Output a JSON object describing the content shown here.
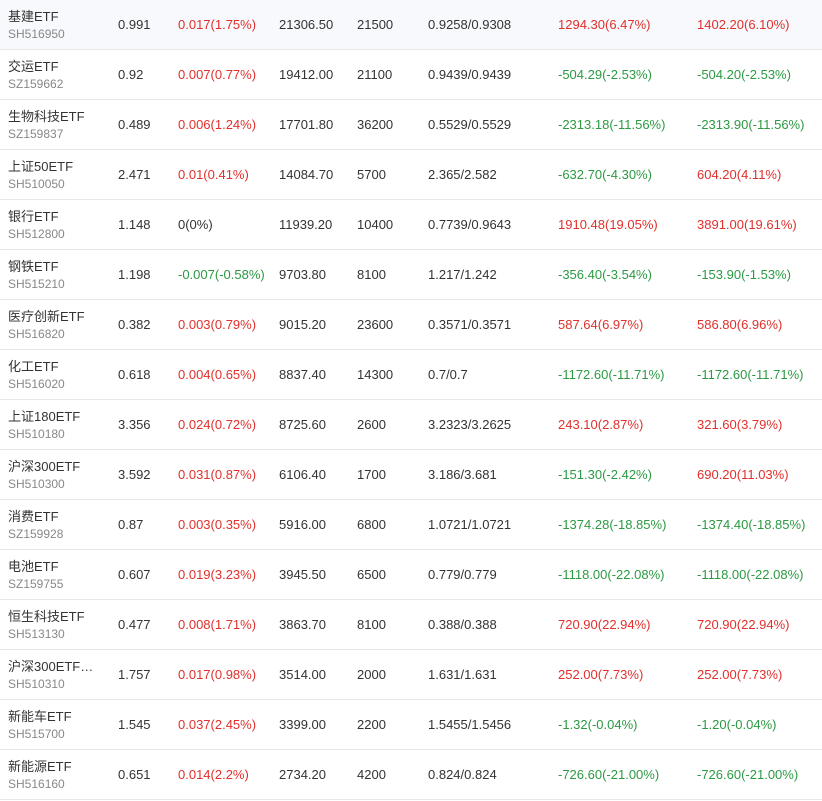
{
  "colors": {
    "up": "#e0302c",
    "down": "#2b9a43",
    "flat": "#333333",
    "text": "#333333",
    "subtext": "#888888",
    "divider": "#e8e8e8"
  },
  "rows": [
    {
      "name": "基建ETF",
      "code": "SH516950",
      "price": "0.991",
      "change": "0.017(1.75%)",
      "change_dir": "up",
      "market_value": "21306.50",
      "quantity": "21500",
      "cost": "0.9258/0.9308",
      "float_pl": "1294.30(6.47%)",
      "float_pl_dir": "up",
      "total_pl": "1402.20(6.10%)",
      "total_pl_dir": "up"
    },
    {
      "name": "交运ETF",
      "code": "SZ159662",
      "price": "0.92",
      "change": "0.007(0.77%)",
      "change_dir": "up",
      "market_value": "19412.00",
      "quantity": "21100",
      "cost": "0.9439/0.9439",
      "float_pl": "-504.29(-2.53%)",
      "float_pl_dir": "down",
      "total_pl": "-504.20(-2.53%)",
      "total_pl_dir": "down"
    },
    {
      "name": "生物科技ETF",
      "code": "SZ159837",
      "price": "0.489",
      "change": "0.006(1.24%)",
      "change_dir": "up",
      "market_value": "17701.80",
      "quantity": "36200",
      "cost": "0.5529/0.5529",
      "float_pl": "-2313.18(-11.56%)",
      "float_pl_dir": "down",
      "total_pl": "-2313.90(-11.56%)",
      "total_pl_dir": "down"
    },
    {
      "name": "上证50ETF",
      "code": "SH510050",
      "price": "2.471",
      "change": "0.01(0.41%)",
      "change_dir": "up",
      "market_value": "14084.70",
      "quantity": "5700",
      "cost": "2.365/2.582",
      "float_pl": "-632.70(-4.30%)",
      "float_pl_dir": "down",
      "total_pl": "604.20(4.11%)",
      "total_pl_dir": "up"
    },
    {
      "name": "银行ETF",
      "code": "SH512800",
      "price": "1.148",
      "change": "0(0%)",
      "change_dir": "flat",
      "market_value": "11939.20",
      "quantity": "10400",
      "cost": "0.7739/0.9643",
      "float_pl": "1910.48(19.05%)",
      "float_pl_dir": "up",
      "total_pl": "3891.00(19.61%)",
      "total_pl_dir": "up"
    },
    {
      "name": "钢铁ETF",
      "code": "SH515210",
      "price": "1.198",
      "change": "-0.007(-0.58%)",
      "change_dir": "down",
      "market_value": "9703.80",
      "quantity": "8100",
      "cost": "1.217/1.242",
      "float_pl": "-356.40(-3.54%)",
      "float_pl_dir": "down",
      "total_pl": "-153.90(-1.53%)",
      "total_pl_dir": "down"
    },
    {
      "name": "医疗创新ETF",
      "code": "SH516820",
      "price": "0.382",
      "change": "0.003(0.79%)",
      "change_dir": "up",
      "market_value": "9015.20",
      "quantity": "23600",
      "cost": "0.3571/0.3571",
      "float_pl": "587.64(6.97%)",
      "float_pl_dir": "up",
      "total_pl": "586.80(6.96%)",
      "total_pl_dir": "up"
    },
    {
      "name": "化工ETF",
      "code": "SH516020",
      "price": "0.618",
      "change": "0.004(0.65%)",
      "change_dir": "up",
      "market_value": "8837.40",
      "quantity": "14300",
      "cost": "0.7/0.7",
      "float_pl": "-1172.60(-11.71%)",
      "float_pl_dir": "down",
      "total_pl": "-1172.60(-11.71%)",
      "total_pl_dir": "down"
    },
    {
      "name": "上证180ETF",
      "code": "SH510180",
      "price": "3.356",
      "change": "0.024(0.72%)",
      "change_dir": "up",
      "market_value": "8725.60",
      "quantity": "2600",
      "cost": "3.2323/3.2625",
      "float_pl": "243.10(2.87%)",
      "float_pl_dir": "up",
      "total_pl": "321.60(3.79%)",
      "total_pl_dir": "up"
    },
    {
      "name": "沪深300ETF",
      "code": "SH510300",
      "price": "3.592",
      "change": "0.031(0.87%)",
      "change_dir": "up",
      "market_value": "6106.40",
      "quantity": "1700",
      "cost": "3.186/3.681",
      "float_pl": "-151.30(-2.42%)",
      "float_pl_dir": "down",
      "total_pl": "690.20(11.03%)",
      "total_pl_dir": "up"
    },
    {
      "name": "消费ETF",
      "code": "SZ159928",
      "price": "0.87",
      "change": "0.003(0.35%)",
      "change_dir": "up",
      "market_value": "5916.00",
      "quantity": "6800",
      "cost": "1.0721/1.0721",
      "float_pl": "-1374.28(-18.85%)",
      "float_pl_dir": "down",
      "total_pl": "-1374.40(-18.85%)",
      "total_pl_dir": "down"
    },
    {
      "name": "电池ETF",
      "code": "SZ159755",
      "price": "0.607",
      "change": "0.019(3.23%)",
      "change_dir": "up",
      "market_value": "3945.50",
      "quantity": "6500",
      "cost": "0.779/0.779",
      "float_pl": "-1118.00(-22.08%)",
      "float_pl_dir": "down",
      "total_pl": "-1118.00(-22.08%)",
      "total_pl_dir": "down"
    },
    {
      "name": "恒生科技ETF",
      "code": "SH513130",
      "price": "0.477",
      "change": "0.008(1.71%)",
      "change_dir": "up",
      "market_value": "3863.70",
      "quantity": "8100",
      "cost": "0.388/0.388",
      "float_pl": "720.90(22.94%)",
      "float_pl_dir": "up",
      "total_pl": "720.90(22.94%)",
      "total_pl_dir": "up"
    },
    {
      "name": "沪深300ETF…",
      "code": "SH510310",
      "price": "1.757",
      "change": "0.017(0.98%)",
      "change_dir": "up",
      "market_value": "3514.00",
      "quantity": "2000",
      "cost": "1.631/1.631",
      "float_pl": "252.00(7.73%)",
      "float_pl_dir": "up",
      "total_pl": "252.00(7.73%)",
      "total_pl_dir": "up"
    },
    {
      "name": "新能车ETF",
      "code": "SH515700",
      "price": "1.545",
      "change": "0.037(2.45%)",
      "change_dir": "up",
      "market_value": "3399.00",
      "quantity": "2200",
      "cost": "1.5455/1.5456",
      "float_pl": "-1.32(-0.04%)",
      "float_pl_dir": "down",
      "total_pl": "-1.20(-0.04%)",
      "total_pl_dir": "down"
    },
    {
      "name": "新能源ETF",
      "code": "SH516160",
      "price": "0.651",
      "change": "0.014(2.2%)",
      "change_dir": "up",
      "market_value": "2734.20",
      "quantity": "4200",
      "cost": "0.824/0.824",
      "float_pl": "-726.60(-21.00%)",
      "float_pl_dir": "down",
      "total_pl": "-726.60(-21.00%)",
      "total_pl_dir": "down"
    }
  ]
}
